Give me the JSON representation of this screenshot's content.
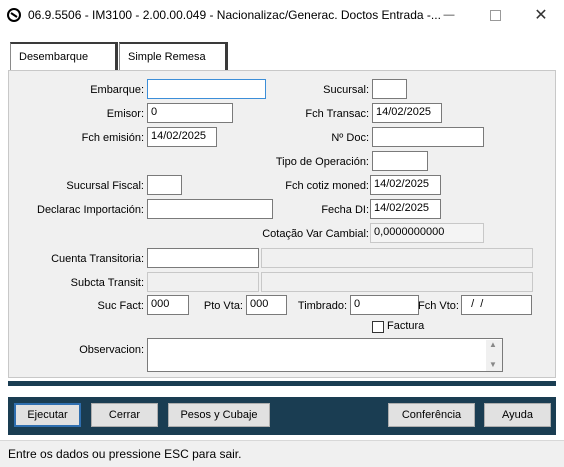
{
  "window": {
    "title": "06.9.5506 - IM3100 - 2.00.00.049 - Nacionalizac/Generac. Doctos Entrada -...",
    "minimize_icon": "minimize-icon",
    "maximize_icon": "maximize-icon",
    "close_icon": "close-icon"
  },
  "tabs": [
    {
      "label": "Desembarque",
      "active": true
    },
    {
      "label": "Simple Remesa",
      "active": false
    }
  ],
  "form": {
    "embarque": {
      "label": "Embarque:",
      "value": ""
    },
    "sucursal": {
      "label": "Sucursal:",
      "value": ""
    },
    "emisor": {
      "label": "Emisor:",
      "value": "0"
    },
    "fch_transac": {
      "label": "Fch Transac:",
      "value": "14/02/2025"
    },
    "fch_emision": {
      "label": "Fch emisión:",
      "value": "14/02/2025"
    },
    "n_doc": {
      "label": "Nº Doc:",
      "value": ""
    },
    "tipo_operacion": {
      "label": "Tipo de Operación:",
      "value": ""
    },
    "sucursal_fiscal": {
      "label": "Sucursal Fiscal:",
      "value": ""
    },
    "fch_cotiz_moned": {
      "label": "Fch cotiz moned:",
      "value": "14/02/2025"
    },
    "declarac_importacion": {
      "label": "Declarac Importación:",
      "value": ""
    },
    "fecha_di": {
      "label": "Fecha DI:",
      "value": "14/02/2025"
    },
    "cotacao_var_cambial": {
      "label": "Cotação Var Cambial:",
      "value": "0,0000000000"
    },
    "cuenta_transitoria": {
      "label": "Cuenta Transitoria:",
      "value": "",
      "description": ""
    },
    "subcta_transit": {
      "label": "Subcta Transit:",
      "value": "",
      "description": ""
    },
    "suc_fact": {
      "label": "Suc Fact:",
      "value": "000"
    },
    "pto_vta": {
      "label": "Pto Vta:",
      "value": "000"
    },
    "timbrado": {
      "label": "Timbrado:",
      "value": "0"
    },
    "fch_vto": {
      "label": "Fch Vto:",
      "value": "  /  /"
    },
    "factura": {
      "label": "Factura",
      "checked": false
    },
    "observacion": {
      "label": "Observacion:",
      "value": ""
    }
  },
  "buttons": {
    "ejecutar": "Ejecutar",
    "cerrar": "Cerrar",
    "pesos_cubaje": "Pesos y Cubaje",
    "conferencia": "Conferência",
    "ayuda": "Ayuda"
  },
  "status_bar": {
    "text": "Entre os dados ou pressione ESC para sair."
  },
  "colors": {
    "footer": "#1a3d52",
    "focus_border": "#3c8ed8"
  }
}
